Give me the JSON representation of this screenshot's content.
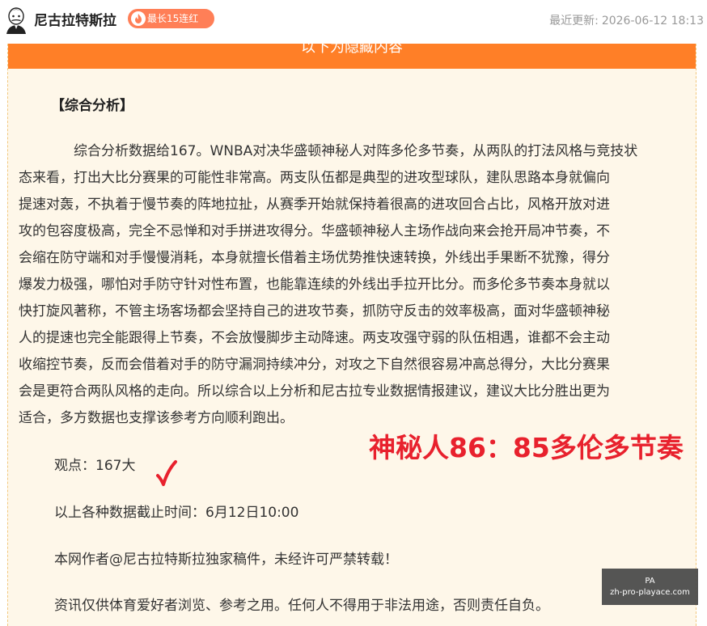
{
  "header": {
    "author_name": "尼古拉特斯拉",
    "streak_badge": "最长15连红",
    "update_label": "最近更新:",
    "update_time": "2026-06-12 18:13"
  },
  "banner": {
    "text": "以下为隐藏内容"
  },
  "article": {
    "section_title": "【综合分析】",
    "analysis_lines": [
      "综合分析数据给167。WNBA对决华盛顿神秘人对阵多伦多节奏，从两队的打法风格与竞技状",
      "态来看，打出大比分赛果的可能性非常高。两支队伍都是典型的进攻型球队，建队思路本身就偏向",
      "提速对轰，不执着于慢节奏的阵地拉扯，从赛季开始就保持着很高的进攻回合占比，风格开放对进",
      "攻的包容度极高，完全不忌惮和对手拼进攻得分。华盛顿神秘人主场作战向来会抢开局冲节奏，不",
      "会缩在防守端和对手慢慢消耗，本身就擅长借着主场优势推快速转换，外线出手果断不犹豫，得分",
      "爆发力极强，哪怕对手防守针对性布置，也能靠连续的外线出手拉开比分。而多伦多节奏本身就以",
      "快打旋风著称，不管主场客场都会坚持自己的进攻节奏，抓防守反击的效率极高，面对华盛顿神秘",
      "人的提速也完全能跟得上节奏，不会放慢脚步主动降速。两支攻强守弱的队伍相遇，谁都不会主动",
      "收缩控节奏，反而会借着对手的防守漏洞持续冲分，对攻之下自然很容易冲高总得分，大比分赛果",
      "会是更符合两队风格的走向。所以综合以上分析和尼古拉专业数据情报建议，建议大比分胜出更为",
      "适合，多方数据也支撑该参考方向顺利跑出。"
    ],
    "viewpoint": "观点：167大",
    "data_cutoff": "以上各种数据截止时间：6月12日10:00",
    "copyright": "本网作者@尼古拉特斯拉独家稿件，未经许可严禁转载！",
    "disclaimer": "资讯仅供体育爱好者浏览、参考之用。任何人不得用于非法用途，否则责任自负。"
  },
  "result_stamp": "神秘人86：85多伦多节奏",
  "watermark": {
    "line1": "PA",
    "line2": "zh-pro-playace.com"
  },
  "colors": {
    "accent_orange": "#ff7f27",
    "badge_orange": "#ff7f57",
    "content_bg": "#fef7e9",
    "stamp_red": "#e8212d"
  },
  "icons": {
    "avatar": "tesla-avatar",
    "badge": "fire-icon",
    "result_mark": "checkmark-icon"
  }
}
